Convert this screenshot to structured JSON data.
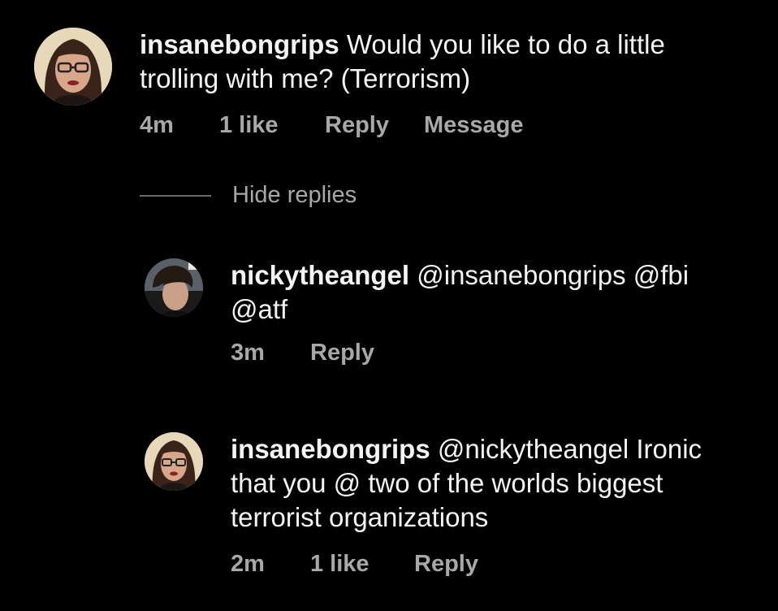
{
  "comments": [
    {
      "username": "insanebongrips",
      "text": "Would you like to do a little trolling with me? (Terrorism)",
      "time": "4m",
      "likes": "1 like",
      "reply": "Reply",
      "message": "Message"
    }
  ],
  "hide_replies": "Hide replies",
  "replies": [
    {
      "username": "nickytheangel",
      "text": "@insanebongrips @fbi @atf",
      "time": "3m",
      "reply": "Reply"
    },
    {
      "username": "insanebongrips",
      "text": "@nickytheangel Ironic that you @ two of the worlds biggest terrorist organizations",
      "time": "2m",
      "likes": "1 like",
      "reply": "Reply"
    }
  ]
}
